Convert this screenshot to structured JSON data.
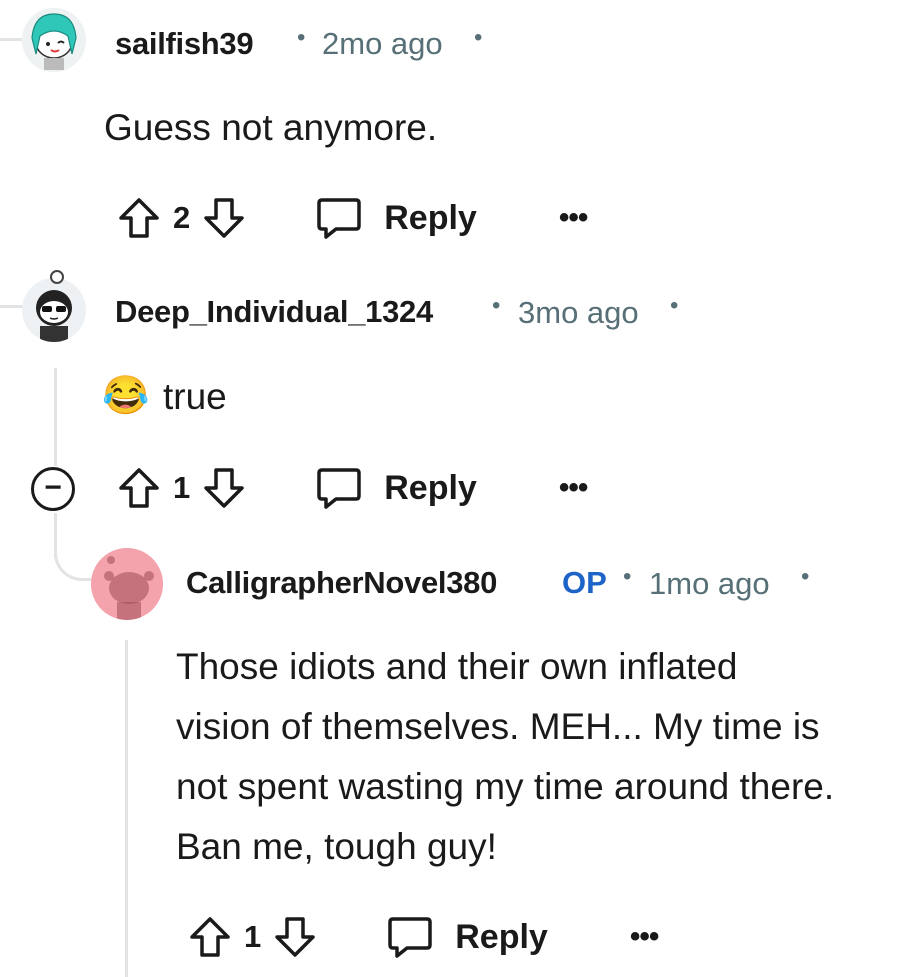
{
  "comments": [
    {
      "username": "sailfish39",
      "sep1": "•",
      "time": "2mo ago",
      "sep2": "•",
      "body": "Guess not anymore.",
      "votes": "2",
      "reply_label": "Reply",
      "more_label": "•••",
      "avatar_icon": "snoo-avatar-teal-hair"
    },
    {
      "username": "Deep_Individual_1324",
      "sep1": "•",
      "time": "3mo ago",
      "sep2": "•",
      "emoji": "😂",
      "body": "true",
      "votes": "1",
      "reply_label": "Reply",
      "more_label": "•••",
      "collapse_label": "−",
      "avatar_icon": "snoo-avatar-sunglasses"
    },
    {
      "username": "CalligrapherNovel380",
      "op_badge": "OP",
      "sep1": "•",
      "time": "1mo ago",
      "sep2": "•",
      "body": "Those idiots and their own inflated vision of themselves. MEH... My time is not spent wasting my time around there. Ban me, tough guy!",
      "votes": "1",
      "reply_label": "Reply",
      "more_label": "•••",
      "avatar_icon": "snoo-avatar-default-pink"
    }
  ],
  "colors": {
    "meta": "#576f76",
    "op": "#1e63c7",
    "thread_line": "#e1e3e5",
    "avatar3_bg": "#f4a3ad"
  }
}
